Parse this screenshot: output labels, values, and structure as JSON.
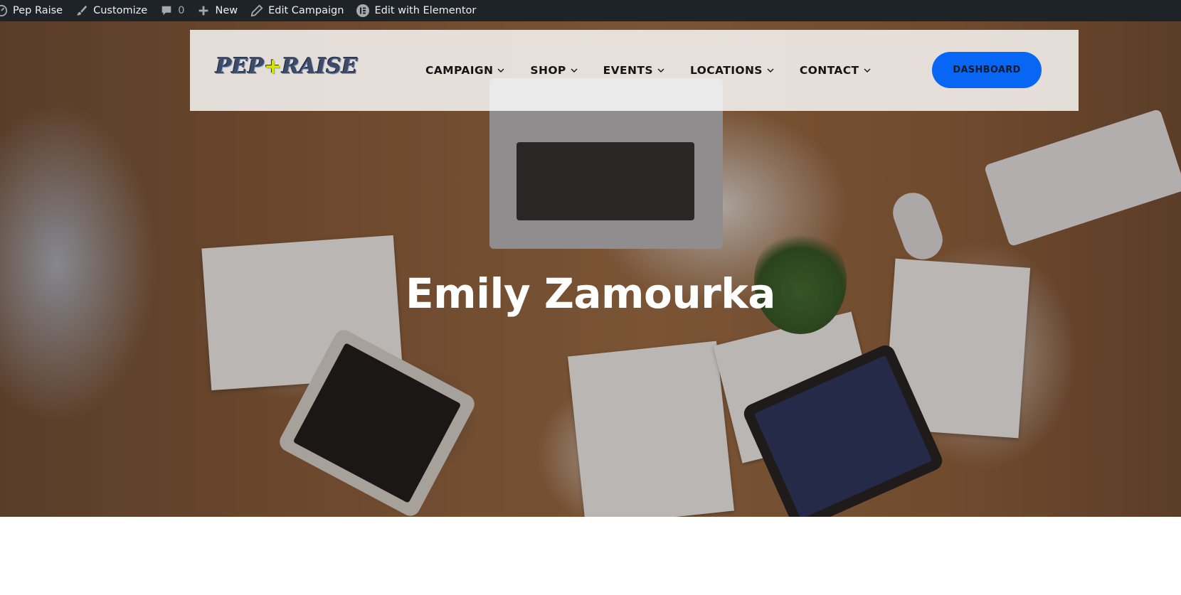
{
  "admin_bar": {
    "site_name": "Pep Raise",
    "customize": "Customize",
    "comments_count": "0",
    "new": "New",
    "edit_campaign": "Edit Campaign",
    "edit_elementor": "Edit with Elementor"
  },
  "header": {
    "logo_left": "PEP",
    "logo_plus": "+",
    "logo_right": "RAISE",
    "nav": [
      {
        "label": "CAMPAIGN"
      },
      {
        "label": "SHOP"
      },
      {
        "label": "EVENTS"
      },
      {
        "label": "LOCATIONS"
      },
      {
        "label": "CONTACT"
      }
    ],
    "dashboard_button": "DASHBOARD"
  },
  "hero": {
    "title": "Emily Zamourka"
  },
  "colors": {
    "admin_bar_bg": "#1d2327",
    "button_blue": "#0866f5",
    "logo_accent": "#d7e600"
  }
}
